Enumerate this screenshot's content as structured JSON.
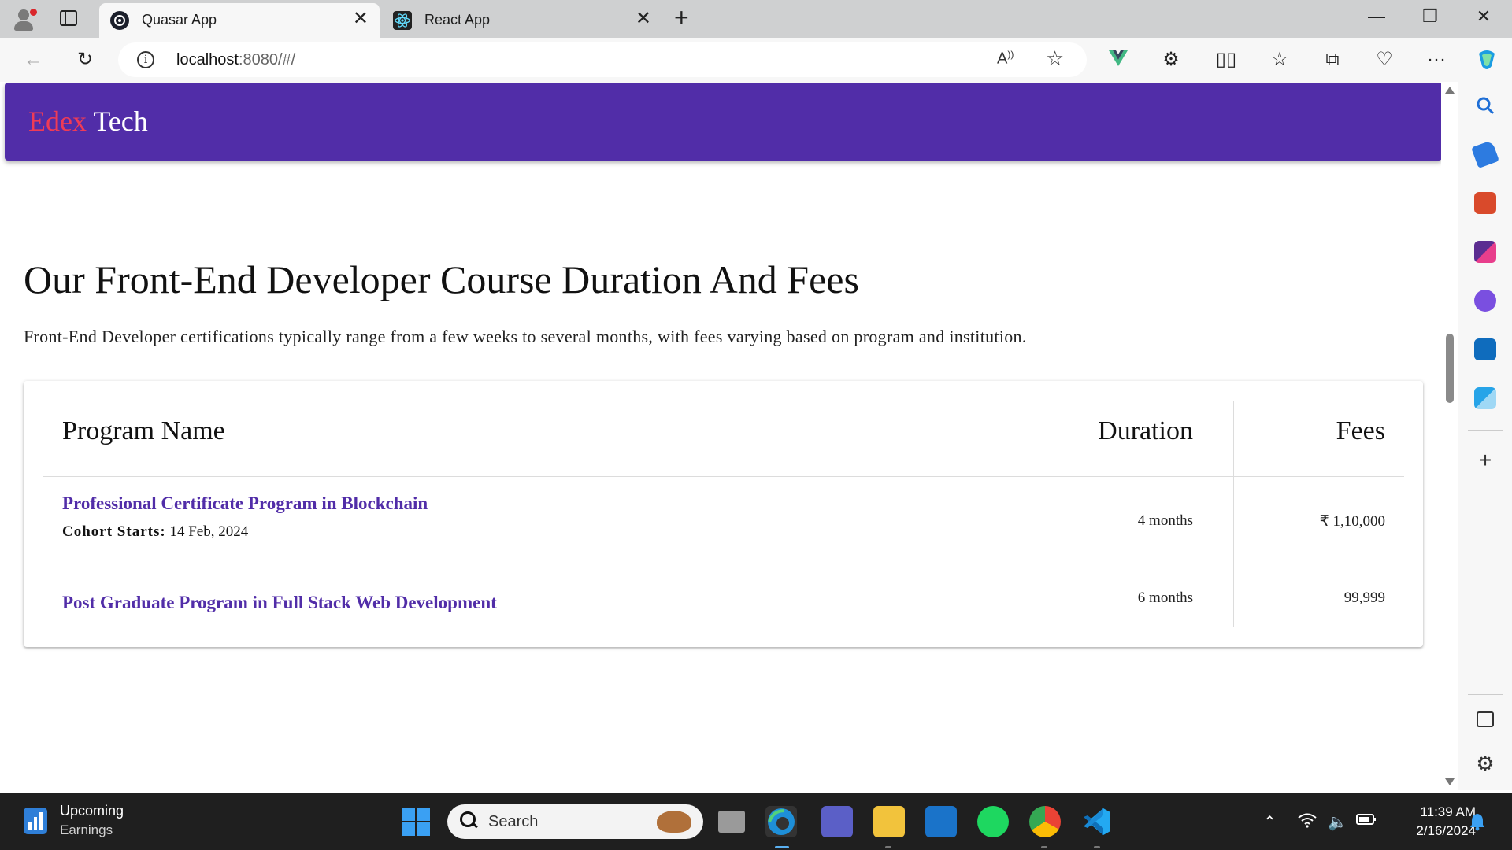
{
  "browser": {
    "tabs": [
      {
        "title": "Quasar App",
        "active": true
      },
      {
        "title": "React App",
        "active": false
      }
    ],
    "address": {
      "host": "localhost",
      "rest": ":8080/#/"
    },
    "read_aloud_label": "Á⁾"
  },
  "app": {
    "brand_part1": "Edex",
    "brand_part2": "Tech",
    "colors": {
      "primary": "#512da8",
      "brand_accent": "#ef3b56"
    }
  },
  "page": {
    "heading": "Our Front-End Developer Course Duration And Fees",
    "lead": "Front-End Developer certifications typically range from a few weeks to several months, with fees varying based on program and institution.",
    "table": {
      "headers": [
        "Program Name",
        "Duration",
        "Fees"
      ],
      "rows": [
        {
          "program": "Professional Certificate Program in Blockchain",
          "cohort_label": "Cohort Starts:",
          "cohort_date": "14 Feb, 2024",
          "duration": "4 months",
          "fees": "₹ 1,10,000"
        },
        {
          "program": "Post Graduate Program in Full Stack Web Development",
          "duration": "6 months",
          "fees": "99,999"
        }
      ]
    }
  },
  "taskbar": {
    "widget_title": "Upcoming",
    "widget_subtitle": "Earnings",
    "search_placeholder": "Search",
    "time": "11:39 AM",
    "date": "2/16/2024"
  }
}
